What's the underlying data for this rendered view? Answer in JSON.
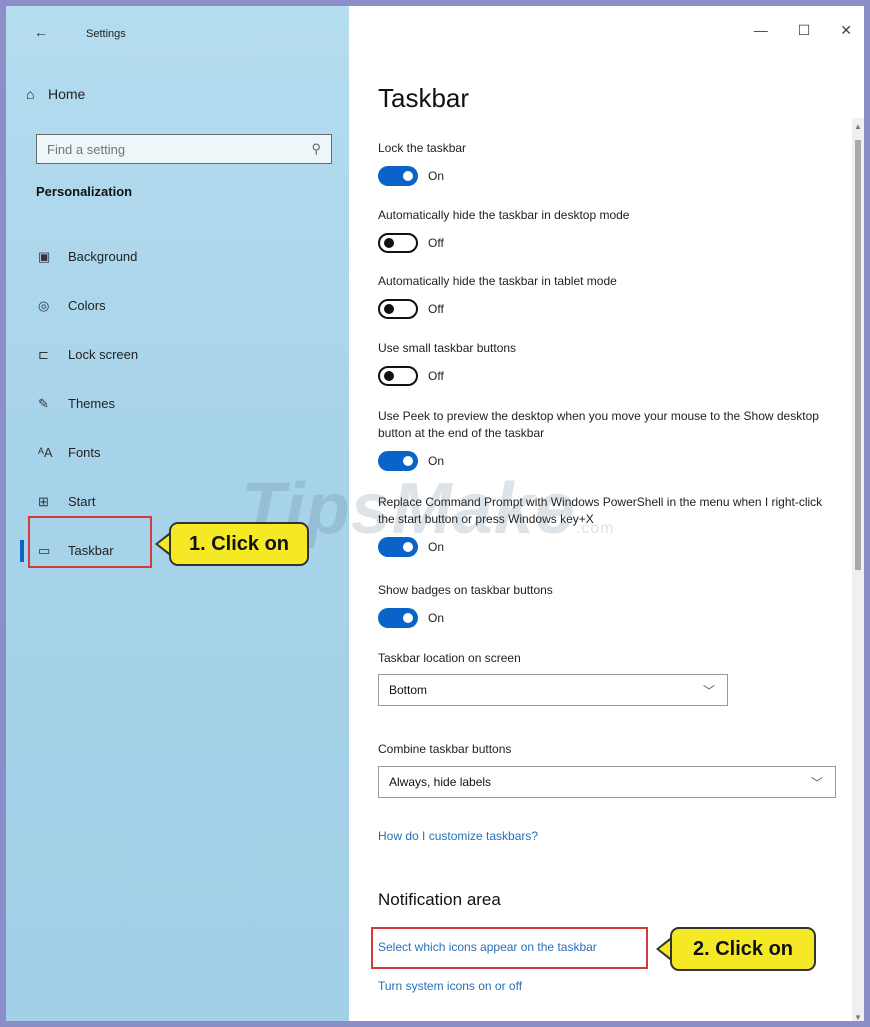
{
  "window": {
    "title": "Settings",
    "back_glyph": "←",
    "minimize_glyph": "—",
    "maximize_glyph": "☐",
    "close_glyph": "✕"
  },
  "sidebar": {
    "home_icon": "⌂",
    "home_label": "Home",
    "search_placeholder": "Find a setting",
    "search_icon": "⚲",
    "section_label": "Personalization",
    "items": [
      {
        "label": "Background",
        "icon": "▣"
      },
      {
        "label": "Colors",
        "icon": "◎"
      },
      {
        "label": "Lock screen",
        "icon": "⊏"
      },
      {
        "label": "Themes",
        "icon": "✎"
      },
      {
        "label": "Fonts",
        "icon": "ᴬA"
      },
      {
        "label": "Start",
        "icon": "⊞"
      },
      {
        "label": "Taskbar",
        "icon": "▭",
        "selected": true
      }
    ],
    "accent_color": "#0a63c9"
  },
  "callouts": {
    "step1": "1. Click on",
    "step2": "2. Click on",
    "color": "#f5e926",
    "highlight_color": "#d33a3a"
  },
  "main": {
    "title": "Taskbar",
    "settings": [
      {
        "label": "Lock the taskbar",
        "state": "On"
      },
      {
        "label": "Automatically hide the taskbar in desktop mode",
        "state": "Off"
      },
      {
        "label": "Automatically hide the taskbar in tablet mode",
        "state": "Off"
      },
      {
        "label": "Use small taskbar buttons",
        "state": "Off"
      },
      {
        "label": "Use Peek to preview the desktop when you move your mouse to the Show desktop button at the end of the taskbar",
        "state": "On"
      },
      {
        "label": "Replace Command Prompt with Windows PowerShell in the menu when I right-click the start button or press Windows key+X",
        "state": "On"
      },
      {
        "label": "Show badges on taskbar buttons",
        "state": "On"
      }
    ],
    "location_label": "Taskbar location on screen",
    "location_value": "Bottom",
    "combine_label": "Combine taskbar buttons",
    "combine_value": "Always, hide labels",
    "customize_link": "How do I customize taskbars?",
    "notification_heading": "Notification area",
    "select_icons_link": "Select which icons appear on the taskbar",
    "system_icons_link": "Turn system icons on or off",
    "link_color": "#2a6fb5"
  },
  "watermark": {
    "text": "TipsMake",
    "suffix": ".com"
  }
}
